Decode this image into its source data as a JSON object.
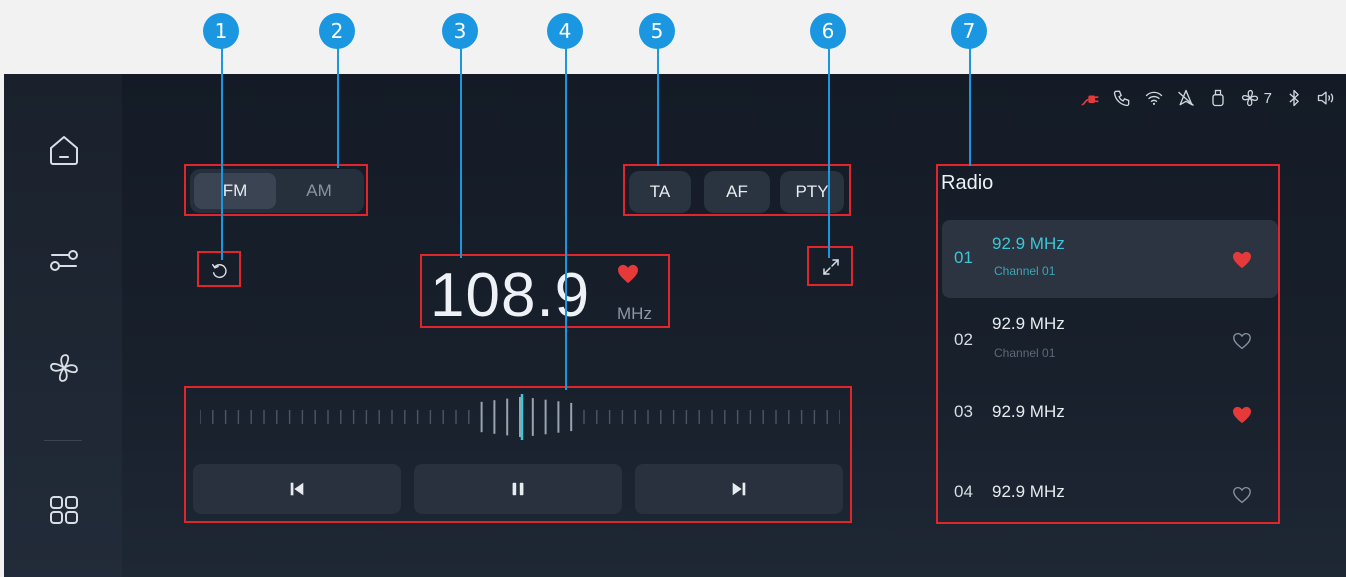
{
  "callouts": [
    "1",
    "2",
    "3",
    "4",
    "5",
    "6",
    "7"
  ],
  "band": {
    "fm_label": "FM",
    "am_label": "AM",
    "selected": "FM"
  },
  "options": {
    "ta_label": "TA",
    "af_label": "AF",
    "pty_label": "PTY"
  },
  "tuner": {
    "frequency": "108.9",
    "unit": "MHz",
    "favorite": true
  },
  "status_bar": {
    "fan_level": "7",
    "icons": [
      "charging-plug-icon",
      "phone-icon",
      "wifi-icon",
      "navigation-off-icon",
      "usb-icon",
      "fan-icon",
      "bluetooth-icon",
      "volume-icon"
    ]
  },
  "sidebar": {
    "items": [
      "home-icon",
      "settings-sliders-icon",
      "fan-icon",
      "apps-grid-icon"
    ]
  },
  "radio_list": {
    "title": "Radio",
    "items": [
      {
        "num": "01",
        "freq": "92.9 MHz",
        "sub": "Channel 01",
        "favorite": true,
        "active": true
      },
      {
        "num": "02",
        "freq": "92.9 MHz",
        "sub": "Channel 01",
        "favorite": false,
        "active": false
      },
      {
        "num": "03",
        "freq": "92.9 MHz",
        "sub": "",
        "favorite": true,
        "active": false
      },
      {
        "num": "04",
        "freq": "92.9 MHz",
        "sub": "",
        "favorite": false,
        "active": false
      }
    ]
  },
  "colors": {
    "accent": "#3cc6d8",
    "favorite": "#e63a3a",
    "callout": "#1a97e0",
    "annotation_box": "#e0262b"
  }
}
